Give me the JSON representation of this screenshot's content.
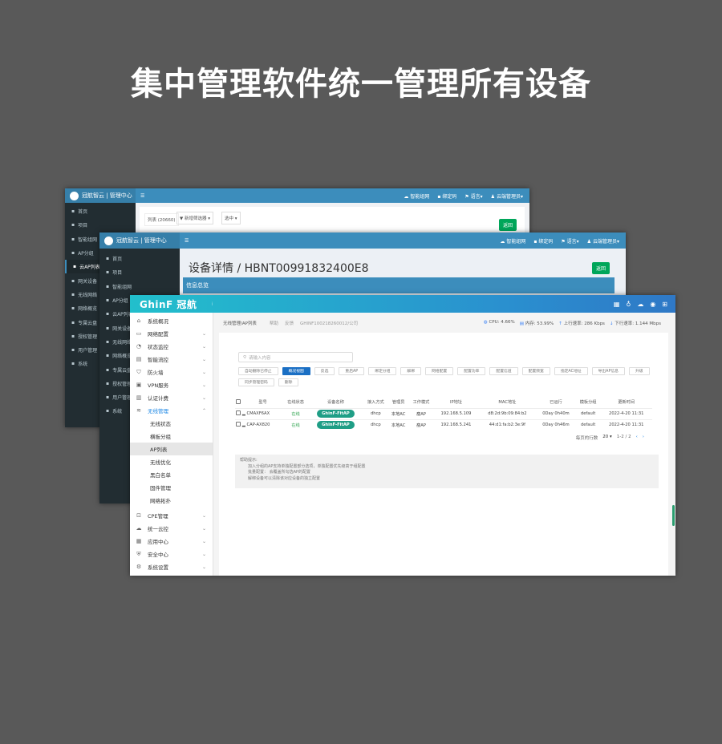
{
  "headline": "集中管理软件统一管理所有设备",
  "w1": {
    "brand": "冠航智云 | 管理中心",
    "header": [
      "智能组网",
      "绑定码",
      "语言▾",
      "云端管理员▾"
    ],
    "sidebar": [
      "首页",
      "项目",
      "智能组网",
      "AP分组",
      "云AP列表",
      "网关设备",
      "无线网络",
      "网络概览",
      "专属云盘",
      "授权管理",
      "用户管理",
      "系统"
    ],
    "active": 4,
    "toolbar": {
      "list": "列表 (20660)",
      "filter": "新增筛选器",
      "selected": "选中"
    },
    "back": "返回"
  },
  "w2": {
    "brand": "冠航智云 | 管理中心",
    "header": [
      "智能组网",
      "绑定码",
      "语言▾",
      "云端管理员▾"
    ],
    "sidebar": [
      "首页",
      "项目",
      "智能组网",
      "AP分组",
      "云AP列表",
      "网关设备",
      "无线网络",
      "网络概览",
      "专属云盘",
      "授权管理",
      "用户管理",
      "系统"
    ],
    "title": "设备详情 / HBNT00991832400E8",
    "section": "信息总览",
    "back": "返回"
  },
  "w3": {
    "logo": "GhinF 冠航",
    "sidebar": [
      {
        "label": "系统概况",
        "icon": "⌂",
        "chev": false
      },
      {
        "label": "网络配置",
        "icon": "▭",
        "chev": true
      },
      {
        "label": "状态监控",
        "icon": "◔",
        "chev": true
      },
      {
        "label": "智能流控",
        "icon": "▤",
        "chev": true
      },
      {
        "label": "防火墙",
        "icon": "⛉",
        "chev": true
      },
      {
        "label": "VPN服务",
        "icon": "▣",
        "chev": true
      },
      {
        "label": "认证计费",
        "icon": "▥",
        "chev": true
      },
      {
        "label": "无线管理",
        "icon": "≋",
        "chev": true,
        "open": true,
        "sub": [
          "无线状态",
          "横板分组",
          "AP列表",
          "无线优化",
          "黑白名单",
          "固件管理",
          "网络拓扑"
        ],
        "selected": 2
      },
      {
        "label": "CPE管理",
        "icon": "⊡",
        "chev": true
      },
      {
        "label": "统一云控",
        "icon": "☁",
        "chev": true
      },
      {
        "label": "应用中心",
        "icon": "▦",
        "chev": true
      },
      {
        "label": "安全中心",
        "icon": "⛨",
        "chev": true
      },
      {
        "label": "系统设置",
        "icon": "⚙",
        "chev": true
      }
    ],
    "breadcrumb": "无线管理/AP列表",
    "help": "帮助",
    "feedback": "反馈",
    "device": "GHINF100218260012/公司",
    "stats": {
      "cpu": "CPU: 4.66%",
      "mem": "内存: 53.99%",
      "up": "上行速率: 286 Kbps",
      "down": "下行速率: 1.144 Mbps"
    },
    "search_placeholder": "请输入内容",
    "buttons": [
      "自动删除已停止",
      "概况视图",
      "反选",
      "重启AP",
      "绑定分组",
      "解绑",
      "网络配置",
      "配置功率",
      "配置信道",
      "配置频宽",
      "指定AC地址",
      "导出AP信息",
      "升级",
      "同步管理密码",
      "删除"
    ],
    "active_button": 1,
    "columns": [
      "型号",
      "在线状态",
      "设备名称",
      "接入方式",
      "管理员",
      "工作模式",
      "IP地址",
      "MAC地址",
      "已运行",
      "模板分组",
      "更新时间"
    ],
    "rows": [
      [
        "CMAXF6AX",
        "在线",
        "GhinF-FitAP",
        "dhcp",
        "本地AC",
        "瘦AP",
        "192.168.5.109",
        "d8:2d:9b:09:84:b2",
        "0Day 0h40m",
        "default",
        "2022-4-20 11:31"
      ],
      [
        "CAP-AX820",
        "在线",
        "GhinF-FitAP",
        "dhcp",
        "本地AC",
        "瘦AP",
        "192.168.5.241",
        "44:d1:fa:b2:3e:9f",
        "0Day 0h46m",
        "default",
        "2022-4-20 11:31"
      ]
    ],
    "pager": {
      "label": "每页的行数",
      "size": "20 ▾",
      "range": "1-2 / 2"
    },
    "help_box": {
      "title": "帮助提示:",
      "lines": [
        "加入分组的AP支持单独配置部分选项，单独配置优先级高于组配置",
        "批量配置： 会覆盖所勾选AP的配置",
        "解绑设备可以清除该对应设备的独立配置"
      ]
    },
    "colors": {
      "header_start": "#22bfcc",
      "header_end": "#2f78c6",
      "pill": "#1f9e86",
      "active_button": "#1a6fc4"
    }
  }
}
